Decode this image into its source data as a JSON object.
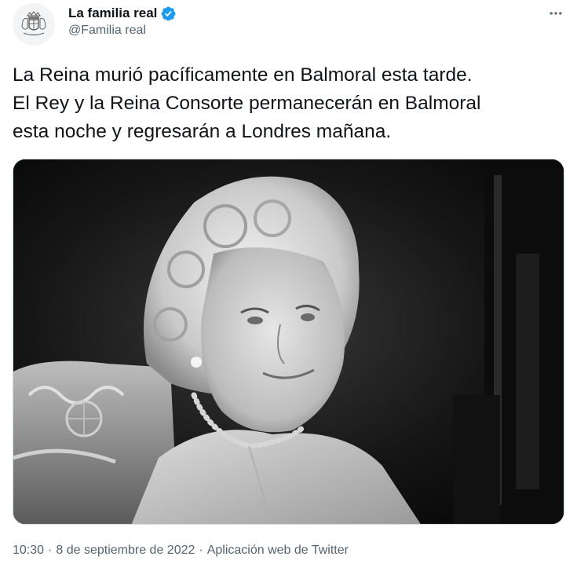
{
  "account": {
    "display_name": "La familia real",
    "handle": "@Familia real",
    "verified": true,
    "avatar_icon": "royal-coat-of-arms-icon"
  },
  "tweet": {
    "text": "La Reina murió pacíficamente en Balmoral esta tarde.\nEl Rey y la Reina Consorte permanecerán en Balmoral\nesta noche y regresarán a Londres mañana.",
    "time": "10:30",
    "separator": "·",
    "date": "8 de septiembre de 2022",
    "source": "Aplicación web de Twitter"
  },
  "icons": {
    "more": "more-options-icon",
    "verified": "verified-badge-icon"
  },
  "colors": {
    "verified_blue": "#1d9bf0",
    "secondary_text": "#536471"
  }
}
